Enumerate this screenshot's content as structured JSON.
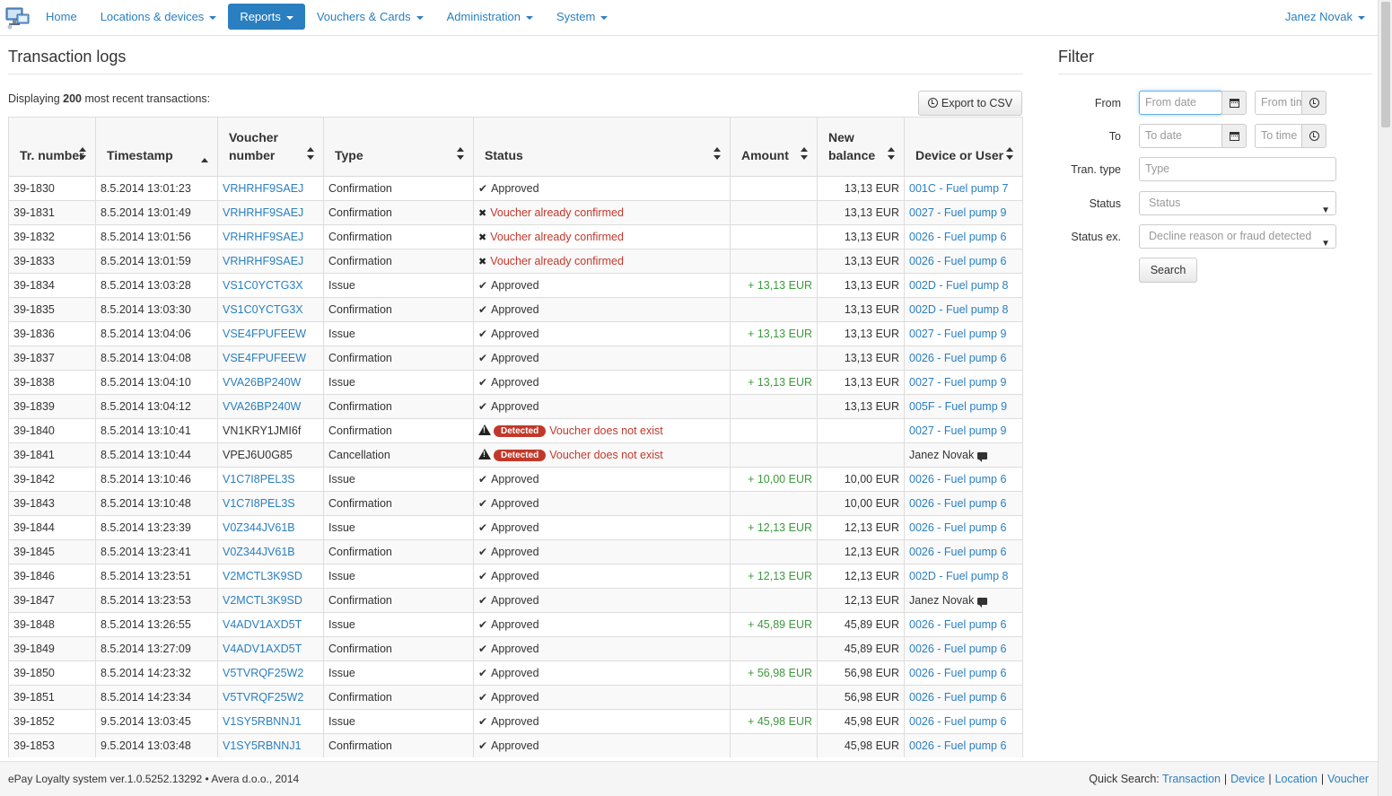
{
  "nav": {
    "items": [
      {
        "label": "Home",
        "caret": false,
        "active": false
      },
      {
        "label": "Locations & devices",
        "caret": true,
        "active": false
      },
      {
        "label": "Reports",
        "caret": true,
        "active": true
      },
      {
        "label": "Vouchers & Cards",
        "caret": true,
        "active": false
      },
      {
        "label": "Administration",
        "caret": true,
        "active": false
      },
      {
        "label": "System",
        "caret": true,
        "active": false
      }
    ],
    "user": "Janez Novak"
  },
  "main": {
    "title": "Transaction logs",
    "displaying_prefix": "Displaying ",
    "displaying_count": "200",
    "displaying_suffix": " most recent transactions:",
    "export_label": "Export to CSV"
  },
  "table": {
    "columns": [
      {
        "label": "Tr. number",
        "sort": "both"
      },
      {
        "label": "Timestamp",
        "sort": "asc"
      },
      {
        "label": "Voucher number",
        "sort": "both"
      },
      {
        "label": "Type",
        "sort": "both"
      },
      {
        "label": "Status",
        "sort": "both"
      },
      {
        "label": "Amount",
        "sort": "both"
      },
      {
        "label": "New balance",
        "sort": "both"
      },
      {
        "label": "Device or User",
        "sort": "both"
      }
    ],
    "rows": [
      {
        "tr": "39-1830",
        "ts": "8.5.2014 13:01:23",
        "voucher": "VRHRHF9SAEJ",
        "voucher_link": true,
        "type": "Confirmation",
        "status": "Approved",
        "status_kind": "ok",
        "amount": "",
        "balance": "13,13 EUR",
        "device": "001C - Fuel pump 7",
        "device_kind": "link"
      },
      {
        "tr": "39-1831",
        "ts": "8.5.2014 13:01:49",
        "voucher": "VRHRHF9SAEJ",
        "voucher_link": true,
        "type": "Confirmation",
        "status": "Voucher already confirmed",
        "status_kind": "error",
        "amount": "",
        "balance": "13,13 EUR",
        "device": "0027 - Fuel pump 9",
        "device_kind": "link"
      },
      {
        "tr": "39-1832",
        "ts": "8.5.2014 13:01:56",
        "voucher": "VRHRHF9SAEJ",
        "voucher_link": true,
        "type": "Confirmation",
        "status": "Voucher already confirmed",
        "status_kind": "error",
        "amount": "",
        "balance": "13,13 EUR",
        "device": "0026 - Fuel pump 6",
        "device_kind": "link"
      },
      {
        "tr": "39-1833",
        "ts": "8.5.2014 13:01:59",
        "voucher": "VRHRHF9SAEJ",
        "voucher_link": true,
        "type": "Confirmation",
        "status": "Voucher already confirmed",
        "status_kind": "error",
        "amount": "",
        "balance": "13,13 EUR",
        "device": "0026 - Fuel pump 6",
        "device_kind": "link"
      },
      {
        "tr": "39-1834",
        "ts": "8.5.2014 13:03:28",
        "voucher": "VS1C0YCTG3X",
        "voucher_link": true,
        "type": "Issue",
        "status": "Approved",
        "status_kind": "ok",
        "amount": "+ 13,13 EUR",
        "balance": "13,13 EUR",
        "device": "002D - Fuel pump 8",
        "device_kind": "link"
      },
      {
        "tr": "39-1835",
        "ts": "8.5.2014 13:03:30",
        "voucher": "VS1C0YCTG3X",
        "voucher_link": true,
        "type": "Confirmation",
        "status": "Approved",
        "status_kind": "ok",
        "amount": "",
        "balance": "13,13 EUR",
        "device": "002D - Fuel pump 8",
        "device_kind": "link"
      },
      {
        "tr": "39-1836",
        "ts": "8.5.2014 13:04:06",
        "voucher": "VSE4FPUFEEW",
        "voucher_link": true,
        "type": "Issue",
        "status": "Approved",
        "status_kind": "ok",
        "amount": "+ 13,13 EUR",
        "balance": "13,13 EUR",
        "device": "0027 - Fuel pump 9",
        "device_kind": "link"
      },
      {
        "tr": "39-1837",
        "ts": "8.5.2014 13:04:08",
        "voucher": "VSE4FPUFEEW",
        "voucher_link": true,
        "type": "Confirmation",
        "status": "Approved",
        "status_kind": "ok",
        "amount": "",
        "balance": "13,13 EUR",
        "device": "0026 - Fuel pump 6",
        "device_kind": "link"
      },
      {
        "tr": "39-1838",
        "ts": "8.5.2014 13:04:10",
        "voucher": "VVA26BP240W",
        "voucher_link": true,
        "type": "Issue",
        "status": "Approved",
        "status_kind": "ok",
        "amount": "+ 13,13 EUR",
        "balance": "13,13 EUR",
        "device": "0027 - Fuel pump 9",
        "device_kind": "link"
      },
      {
        "tr": "39-1839",
        "ts": "8.5.2014 13:04:12",
        "voucher": "VVA26BP240W",
        "voucher_link": true,
        "type": "Confirmation",
        "status": "Approved",
        "status_kind": "ok",
        "amount": "",
        "balance": "13,13 EUR",
        "device": "005F - Fuel pump 9",
        "device_kind": "link"
      },
      {
        "tr": "39-1840",
        "ts": "8.5.2014 13:10:41",
        "voucher": "VN1KRY1JMI6f",
        "voucher_link": false,
        "type": "Confirmation",
        "status": "Voucher does not exist",
        "status_kind": "detected",
        "badge": "Detected",
        "amount": "",
        "balance": "",
        "device": "0027 - Fuel pump 9",
        "device_kind": "link"
      },
      {
        "tr": "39-1841",
        "ts": "8.5.2014 13:10:44",
        "voucher": "VPEJ6U0G85",
        "voucher_link": false,
        "type": "Cancellation",
        "status": "Voucher does not exist",
        "status_kind": "detected",
        "badge": "Detected",
        "amount": "",
        "balance": "",
        "device": "Janez Novak",
        "device_kind": "user"
      },
      {
        "tr": "39-1842",
        "ts": "8.5.2014 13:10:46",
        "voucher": "V1C7I8PEL3S",
        "voucher_link": true,
        "type": "Issue",
        "status": "Approved",
        "status_kind": "ok",
        "amount": "+ 10,00 EUR",
        "balance": "10,00 EUR",
        "device": "0026 - Fuel pump 6",
        "device_kind": "link"
      },
      {
        "tr": "39-1843",
        "ts": "8.5.2014 13:10:48",
        "voucher": "V1C7I8PEL3S",
        "voucher_link": true,
        "type": "Confirmation",
        "status": "Approved",
        "status_kind": "ok",
        "amount": "",
        "balance": "10,00 EUR",
        "device": "0026 - Fuel pump 6",
        "device_kind": "link"
      },
      {
        "tr": "39-1844",
        "ts": "8.5.2014 13:23:39",
        "voucher": "V0Z344JV61B",
        "voucher_link": true,
        "type": "Issue",
        "status": "Approved",
        "status_kind": "ok",
        "amount": "+ 12,13 EUR",
        "balance": "12,13 EUR",
        "device": "0026 - Fuel pump 6",
        "device_kind": "link"
      },
      {
        "tr": "39-1845",
        "ts": "8.5.2014 13:23:41",
        "voucher": "V0Z344JV61B",
        "voucher_link": true,
        "type": "Confirmation",
        "status": "Approved",
        "status_kind": "ok",
        "amount": "",
        "balance": "12,13 EUR",
        "device": "0026 - Fuel pump 6",
        "device_kind": "link"
      },
      {
        "tr": "39-1846",
        "ts": "8.5.2014 13:23:51",
        "voucher": "V2MCTL3K9SD",
        "voucher_link": true,
        "type": "Issue",
        "status": "Approved",
        "status_kind": "ok",
        "amount": "+ 12,13 EUR",
        "balance": "12,13 EUR",
        "device": "002D - Fuel pump 8",
        "device_kind": "link"
      },
      {
        "tr": "39-1847",
        "ts": "8.5.2014 13:23:53",
        "voucher": "V2MCTL3K9SD",
        "voucher_link": true,
        "type": "Confirmation",
        "status": "Approved",
        "status_kind": "ok",
        "amount": "",
        "balance": "12,13 EUR",
        "device": "Janez Novak",
        "device_kind": "user"
      },
      {
        "tr": "39-1848",
        "ts": "8.5.2014 13:26:55",
        "voucher": "V4ADV1AXD5T",
        "voucher_link": true,
        "type": "Issue",
        "status": "Approved",
        "status_kind": "ok",
        "amount": "+ 45,89 EUR",
        "balance": "45,89 EUR",
        "device": "0026 - Fuel pump 6",
        "device_kind": "link"
      },
      {
        "tr": "39-1849",
        "ts": "8.5.2014 13:27:09",
        "voucher": "V4ADV1AXD5T",
        "voucher_link": true,
        "type": "Confirmation",
        "status": "Approved",
        "status_kind": "ok",
        "amount": "",
        "balance": "45,89 EUR",
        "device": "0026 - Fuel pump 6",
        "device_kind": "link"
      },
      {
        "tr": "39-1850",
        "ts": "8.5.2014 14:23:32",
        "voucher": "V5TVRQF25W2",
        "voucher_link": true,
        "type": "Issue",
        "status": "Approved",
        "status_kind": "ok",
        "amount": "+ 56,98 EUR",
        "balance": "56,98 EUR",
        "device": "0026 - Fuel pump 6",
        "device_kind": "link"
      },
      {
        "tr": "39-1851",
        "ts": "8.5.2014 14:23:34",
        "voucher": "V5TVRQF25W2",
        "voucher_link": true,
        "type": "Confirmation",
        "status": "Approved",
        "status_kind": "ok",
        "amount": "",
        "balance": "56,98 EUR",
        "device": "0026 - Fuel pump 6",
        "device_kind": "link"
      },
      {
        "tr": "39-1852",
        "ts": "9.5.2014 13:03:45",
        "voucher": "V1SY5RBNNJ1",
        "voucher_link": true,
        "type": "Issue",
        "status": "Approved",
        "status_kind": "ok",
        "amount": "+ 45,98 EUR",
        "balance": "45,98 EUR",
        "device": "0026 - Fuel pump 6",
        "device_kind": "link"
      },
      {
        "tr": "39-1853",
        "ts": "9.5.2014 13:03:48",
        "voucher": "V1SY5RBNNJ1",
        "voucher_link": true,
        "type": "Confirmation",
        "status": "Approved",
        "status_kind": "ok",
        "amount": "",
        "balance": "45,98 EUR",
        "device": "0026 - Fuel pump 6",
        "device_kind": "link"
      }
    ]
  },
  "filter": {
    "title": "Filter",
    "from_label": "From",
    "from_date_placeholder": "From date",
    "from_time_placeholder": "From time",
    "to_label": "To",
    "to_date_placeholder": "To date",
    "to_time_placeholder": "To time",
    "tran_type_label": "Tran. type",
    "tran_type_placeholder": "Type",
    "status_label": "Status",
    "status_value": "Status",
    "status_ex_label": "Status ex.",
    "status_ex_value": "Decline reason or fraud detected",
    "search_label": "Search"
  },
  "footer": {
    "left": "ePay Loyalty system ver.1.0.5252.13292 • Avera d.o.o., 2014",
    "quick_search_label": "Quick Search:",
    "links": [
      "Transaction",
      "Device",
      "Location",
      "Voucher"
    ]
  },
  "colors": {
    "link": "#2a7fc0",
    "error": "#c0392b",
    "amount": "#3c9a3c"
  },
  "icons": {
    "logo": "computer-network-icon",
    "export": "clock-icon",
    "date_picker": "calendar-icon",
    "time_picker": "clock-icon",
    "ok_status": "checkmark-icon",
    "error_status": "cross-icon",
    "detected_status": "warning-icon",
    "user_device": "comment-icon"
  }
}
